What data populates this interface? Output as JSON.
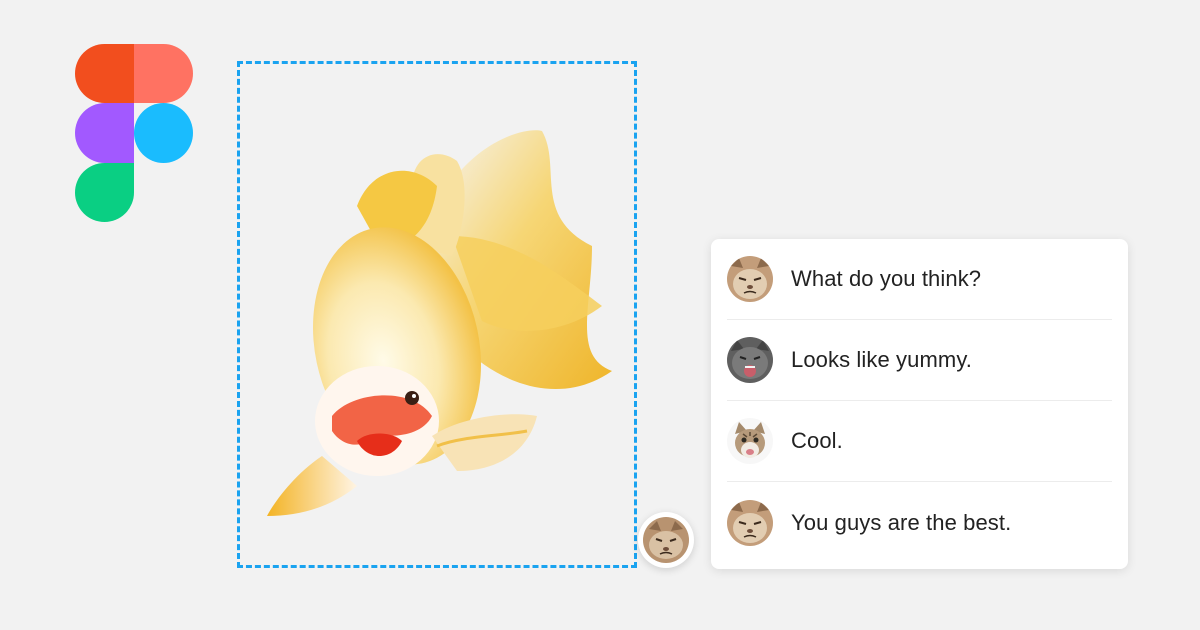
{
  "logo": {
    "icon": "figma-logo-icon",
    "colors": {
      "top_left": "#f24e1e",
      "top_right": "#ff7262",
      "middle_left": "#a259ff",
      "middle_right": "#1abcfe",
      "bottom_left": "#0acf83"
    }
  },
  "canvas": {
    "selection_color": "#1aa3f0",
    "image_icon": "goldfish-image"
  },
  "cursor_avatar": {
    "icon": "cat-avatar-icon"
  },
  "comments": [
    {
      "avatar": "grumpy-cat-avatar",
      "text": "What do you think?"
    },
    {
      "avatar": "gray-cat-avatar",
      "text": "Looks like yummy."
    },
    {
      "avatar": "tabby-cat-avatar",
      "text": "Cool."
    },
    {
      "avatar": "grumpy-cat-avatar",
      "text": "You guys are the best."
    }
  ]
}
